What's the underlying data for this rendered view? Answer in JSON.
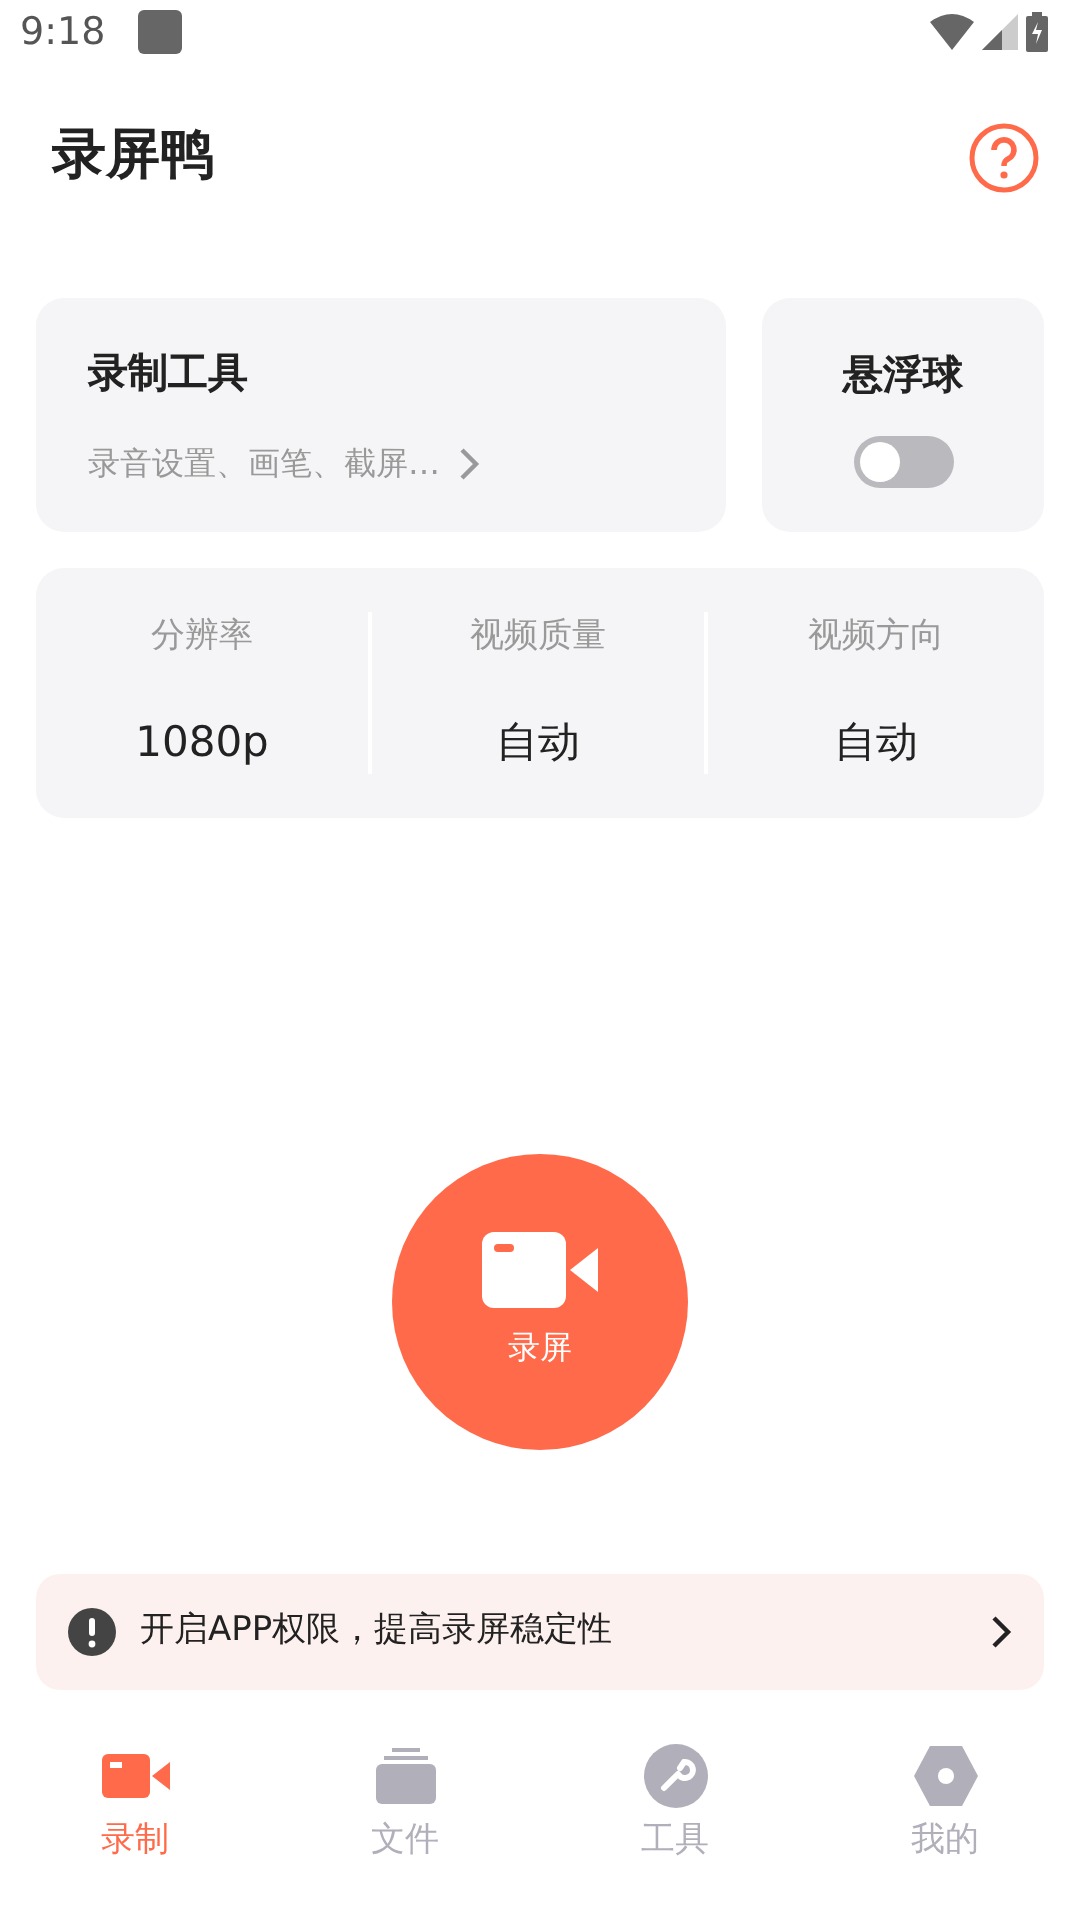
{
  "status_bar": {
    "time": "9:18"
  },
  "header": {
    "title": "录屏鸭"
  },
  "tools_card": {
    "title": "录制工具",
    "subtitle": "录音设置、画笔、截屏…"
  },
  "float_ball": {
    "title": "悬浮球",
    "on": false
  },
  "settings": [
    {
      "label": "分辨率",
      "value": "1080p"
    },
    {
      "label": "视频质量",
      "value": "自动"
    },
    {
      "label": "视频方向",
      "value": "自动"
    }
  ],
  "record_button": {
    "label": "录屏"
  },
  "banner": {
    "text": "开启APP权限，提高录屏稳定性"
  },
  "tabs": [
    {
      "label": "录制",
      "kind": "record",
      "selected": true
    },
    {
      "label": "文件",
      "kind": "files",
      "selected": false
    },
    {
      "label": "工具",
      "kind": "tools",
      "selected": false
    },
    {
      "label": "我的",
      "kind": "me",
      "selected": false
    }
  ]
}
